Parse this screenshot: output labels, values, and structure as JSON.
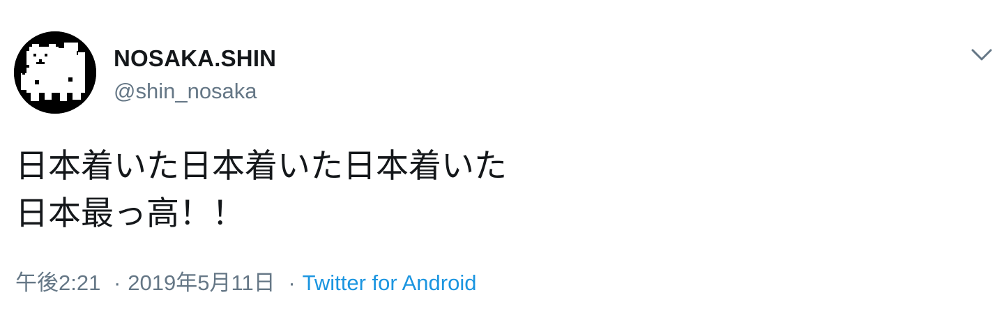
{
  "user": {
    "display_name": "NOSAKA.SHIN",
    "handle": "@shin_nosaka",
    "avatar_icon": "dog-pixel-avatar"
  },
  "menu_icon": "chevron-down-icon",
  "tweet": {
    "lines": [
      "日本着いた日本着いた日本着いた",
      "日本最っ高！！"
    ]
  },
  "meta": {
    "time": "午後2:21",
    "separator": "·",
    "date": "2019年5月11日",
    "source": "Twitter for Android"
  },
  "colors": {
    "name": "#14171a",
    "secondary": "#657786",
    "link": "#1b95e0"
  }
}
